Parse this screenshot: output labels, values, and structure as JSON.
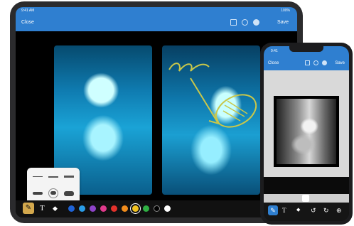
{
  "ipad": {
    "status_time": "9:41 AM",
    "status_right": "100%",
    "nav": {
      "close_label": "Close",
      "save_label": "Save"
    },
    "toolbar": {
      "text_tool": "T",
      "eraser": "◆",
      "redo": "↻",
      "colors": [
        "#1e63d6",
        "#2a9de8",
        "#8e44c9",
        "#e03a8c",
        "#e2312b",
        "#f08c1c",
        "#f2c21f",
        "#2fb043",
        "#000000",
        "#ffffff"
      ]
    }
  },
  "iphone": {
    "status_time": "9:41",
    "nav": {
      "close_label": "Close",
      "save_label": "Save"
    },
    "toolbar": {
      "text_tool": "T",
      "eraser": "◆",
      "undo": "↺",
      "redo": "↻",
      "add": "⊕"
    }
  }
}
